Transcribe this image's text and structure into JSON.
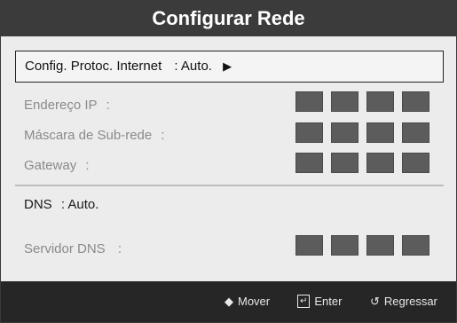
{
  "dialog": {
    "title": "Configurar Rede"
  },
  "protocol_row": {
    "label": "Config. Protoc. Internet",
    "value": ": Auto.",
    "arrow_icon": "right-triangle-icon"
  },
  "ip_fields": {
    "ip_address_label": "Endereço IP",
    "ip_address_sep": ":",
    "subnet_mask_label": "Máscara de Sub-rede",
    "subnet_mask_sep": ":",
    "gateway_label": "Gateway",
    "gateway_sep": ":"
  },
  "dns_row": {
    "label": "DNS",
    "value": ": Auto."
  },
  "dns_server": {
    "label": "Servidor DNS",
    "sep": ":"
  },
  "footer": {
    "move_icon": "up-down-arrows-icon",
    "move_label": "Mover",
    "enter_icon": "enter-icon",
    "enter_label": "Enter",
    "return_icon": "return-icon",
    "return_label": "Regressar"
  },
  "colors": {
    "title_bg": "#3b3b3b",
    "panel_bg": "#ececec",
    "footer_bg": "#262626",
    "ip_box": "#5c5c5c",
    "disabled_text": "#8a8a8a"
  }
}
